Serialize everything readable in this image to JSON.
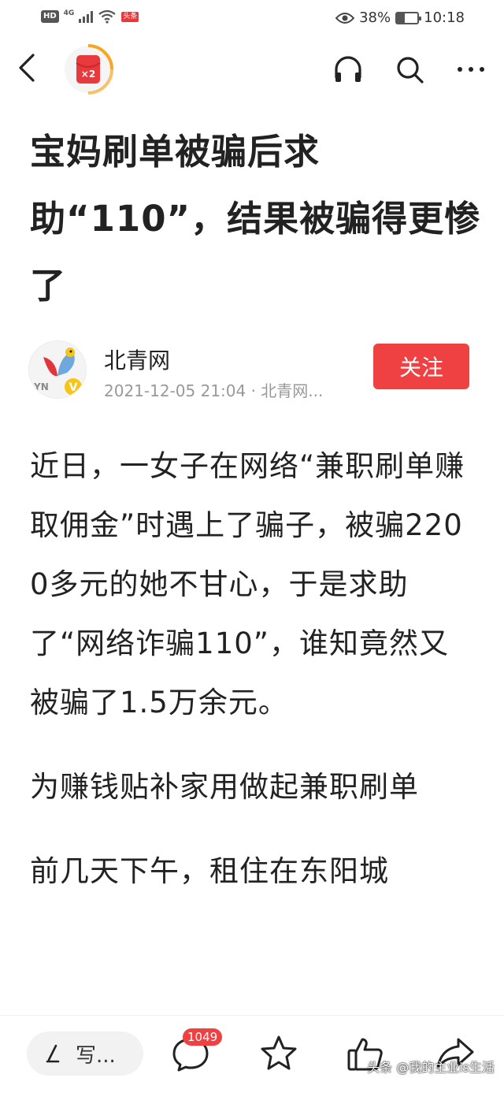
{
  "status_bar": {
    "hd": "HD",
    "network": "4G",
    "app_badge": "头条",
    "battery_text": "38%",
    "battery_level": 0.38,
    "time": "10:18"
  },
  "nav": {
    "reward_label": "×2"
  },
  "article": {
    "title": "宝妈刷单被骗后求助“110”，结果被骗得更惨了",
    "author": {
      "name": "北青网",
      "meta": "2021-12-05 21:04 · 北青网...",
      "avatar_text": "YN",
      "verified_mark": "V",
      "follow_label": "关注"
    },
    "paragraphs": [
      "近日，一女子在网络“兼职刷单赚取佣金”时遇上了骗子，被骗2200多元的她不甘心，于是求助了“网络诈骗110”，谁知竟然又被骗了1.5万余元。",
      "为赚钱贴补家用做起兼职刷单",
      "前几天下午，租住在东阳城"
    ]
  },
  "bottom_bar": {
    "comment_placeholder": "写...",
    "comment_count": "1049",
    "watermark": "头条 @我的主业is生活"
  }
}
